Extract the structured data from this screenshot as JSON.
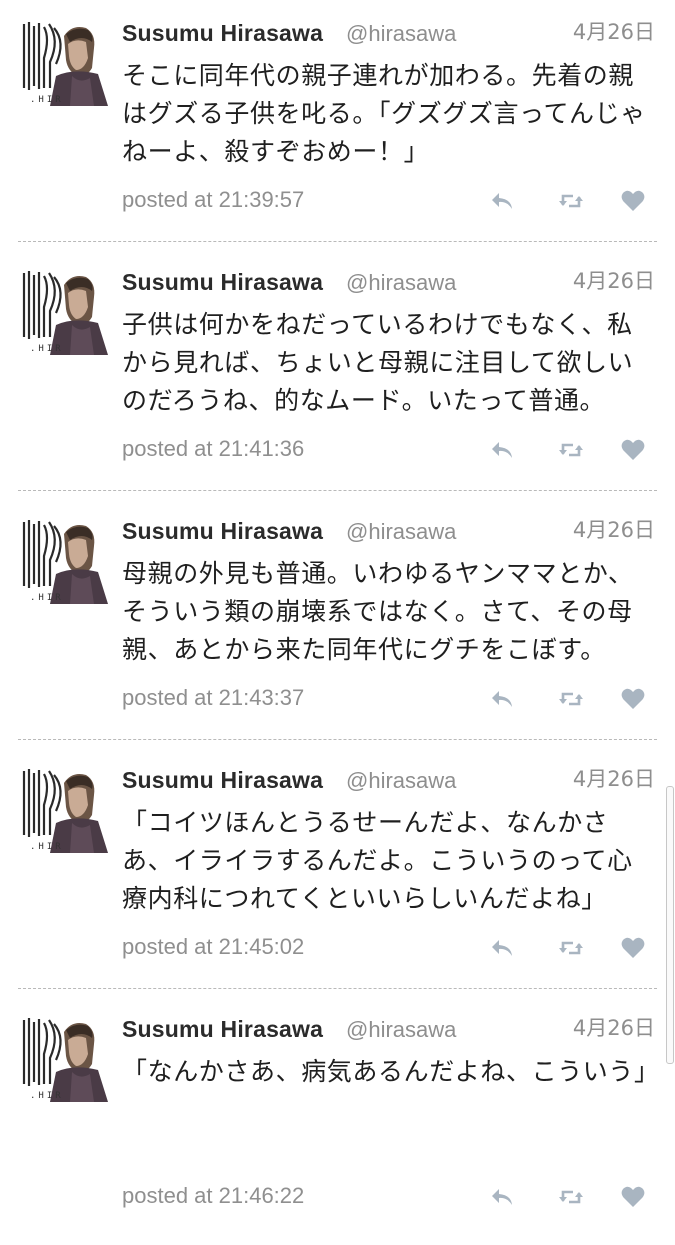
{
  "tweets": [
    {
      "author": "Susumu Hirasawa",
      "handle": "@hirasawa",
      "date": "4月26日",
      "text": "そこに同年代の親子連れが加わる。先着の親はグズる子供を叱る。「グズグズ言ってんじゃねーよ、殺すぞおめー！」",
      "posted": "posted at 21:39:57"
    },
    {
      "author": "Susumu Hirasawa",
      "handle": "@hirasawa",
      "date": "4月26日",
      "text": "子供は何かをねだっているわけでもなく、私から見れば、ちょいと母親に注目して欲しいのだろうね、的なムード。いたって普通。",
      "posted": "posted at 21:41:36"
    },
    {
      "author": "Susumu Hirasawa",
      "handle": "@hirasawa",
      "date": "4月26日",
      "text": "母親の外見も普通。いわゆるヤンママとか、そういう類の崩壊系ではなく。さて、その母親、あとから来た同年代にグチをこぼす。",
      "posted": "posted at 21:43:37"
    },
    {
      "author": "Susumu Hirasawa",
      "handle": "@hirasawa",
      "date": "4月26日",
      "text": "「コイツほんとうるせーんだよ、なんかさあ、イライラするんだよ。こういうのって心療内科につれてくといいらしいんだよね」",
      "posted": "posted at 21:45:02"
    },
    {
      "author": "Susumu Hirasawa",
      "handle": "@hirasawa",
      "date": "4月26日",
      "text": "「なんかさあ、病気あるんだよね、こういう」",
      "posted": "posted at 21:46:22"
    }
  ],
  "icons": {
    "reply": "reply-icon",
    "retweet": "retweet-icon",
    "favorite": "heart-icon"
  },
  "colors": {
    "background": "#ffffff",
    "name": "#2b2b2b",
    "muted": "#8e8e8e",
    "icon": "#a9b5c1",
    "separator": "#b9b9b9"
  }
}
